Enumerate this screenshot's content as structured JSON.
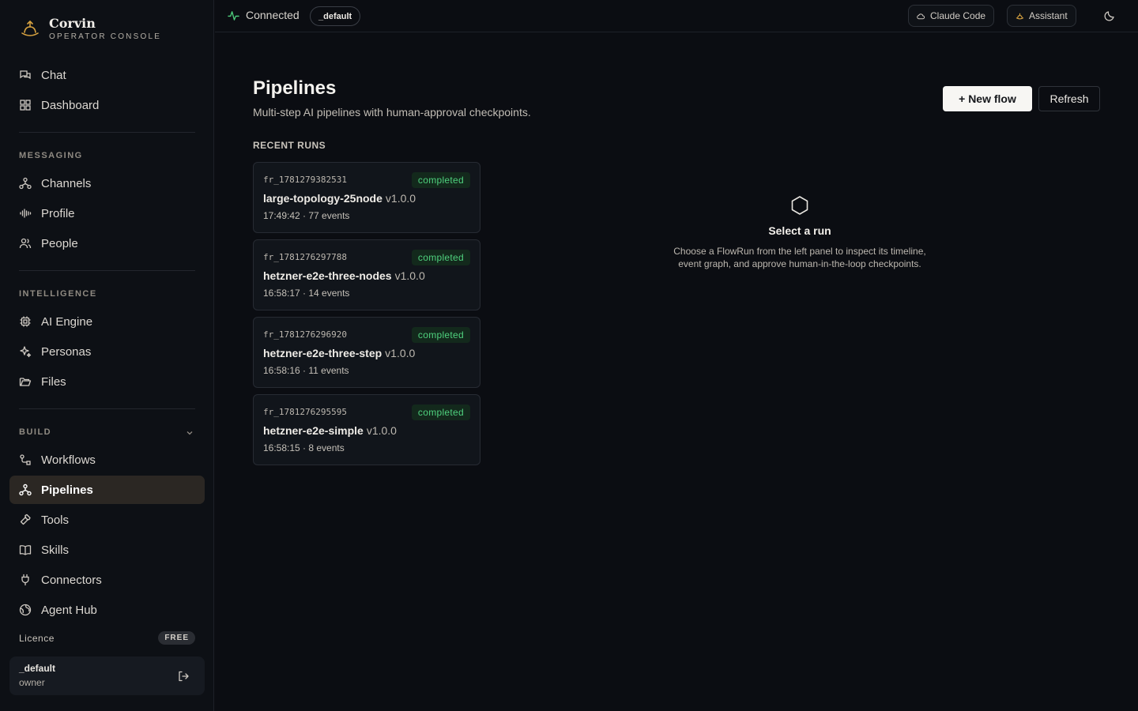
{
  "brand": {
    "name": "Corvin",
    "subtitle": "OPERATOR CONSOLE"
  },
  "sidebar": {
    "top_items": [
      {
        "label": "Chat",
        "icon": "chat-icon"
      },
      {
        "label": "Dashboard",
        "icon": "dashboard-icon"
      }
    ],
    "sections": [
      {
        "label": "MESSAGING",
        "items": [
          {
            "label": "Channels",
            "icon": "channels-icon"
          },
          {
            "label": "Profile",
            "icon": "audio-wave-icon"
          },
          {
            "label": "People",
            "icon": "people-icon"
          }
        ]
      },
      {
        "label": "INTELLIGENCE",
        "items": [
          {
            "label": "AI Engine",
            "icon": "cpu-icon"
          },
          {
            "label": "Personas",
            "icon": "sparkles-icon"
          },
          {
            "label": "Files",
            "icon": "folder-icon"
          }
        ]
      },
      {
        "label": "BUILD",
        "items": [
          {
            "label": "Workflows",
            "icon": "workflow-icon"
          },
          {
            "label": "Pipelines",
            "icon": "pipeline-icon",
            "active": true
          },
          {
            "label": "Tools",
            "icon": "hammer-icon"
          },
          {
            "label": "Skills",
            "icon": "book-icon"
          },
          {
            "label": "Connectors",
            "icon": "plug-icon"
          },
          {
            "label": "Agent Hub",
            "icon": "globe-icon"
          }
        ]
      }
    ],
    "licence": {
      "label": "Licence",
      "badge": "FREE"
    },
    "user": {
      "name": "_default",
      "role": "owner"
    }
  },
  "topbar": {
    "status": "Connected",
    "tenant": "_default",
    "claude_code_label": "Claude Code",
    "assistant_label": "Assistant"
  },
  "main": {
    "title": "Pipelines",
    "subtitle": "Multi-step AI pipelines with human-approval checkpoints.",
    "new_flow_label": "+ New flow",
    "refresh_label": "Refresh",
    "recent_label": "RECENT RUNS",
    "runs": [
      {
        "id": "fr_1781279382531",
        "status": "completed",
        "name": "large-topology-25node",
        "version": "v1.0.0",
        "meta": "17:49:42 · 77 events"
      },
      {
        "id": "fr_1781276297788",
        "status": "completed",
        "name": "hetzner-e2e-three-nodes",
        "version": "v1.0.0",
        "meta": "16:58:17 · 14 events"
      },
      {
        "id": "fr_1781276296920",
        "status": "completed",
        "name": "hetzner-e2e-three-step",
        "version": "v1.0.0",
        "meta": "16:58:16 · 11 events"
      },
      {
        "id": "fr_1781276295595",
        "status": "completed",
        "name": "hetzner-e2e-simple",
        "version": "v1.0.0",
        "meta": "16:58:15 · 8 events"
      }
    ],
    "empty": {
      "title": "Select a run",
      "description": "Choose a FlowRun from the left panel to inspect its timeline, event graph, and approve human-in-the-loop checkpoints."
    }
  },
  "colors": {
    "accent_logo": "#d9a441",
    "status_green": "#4fd17e",
    "active_bg": "#2b2723"
  }
}
